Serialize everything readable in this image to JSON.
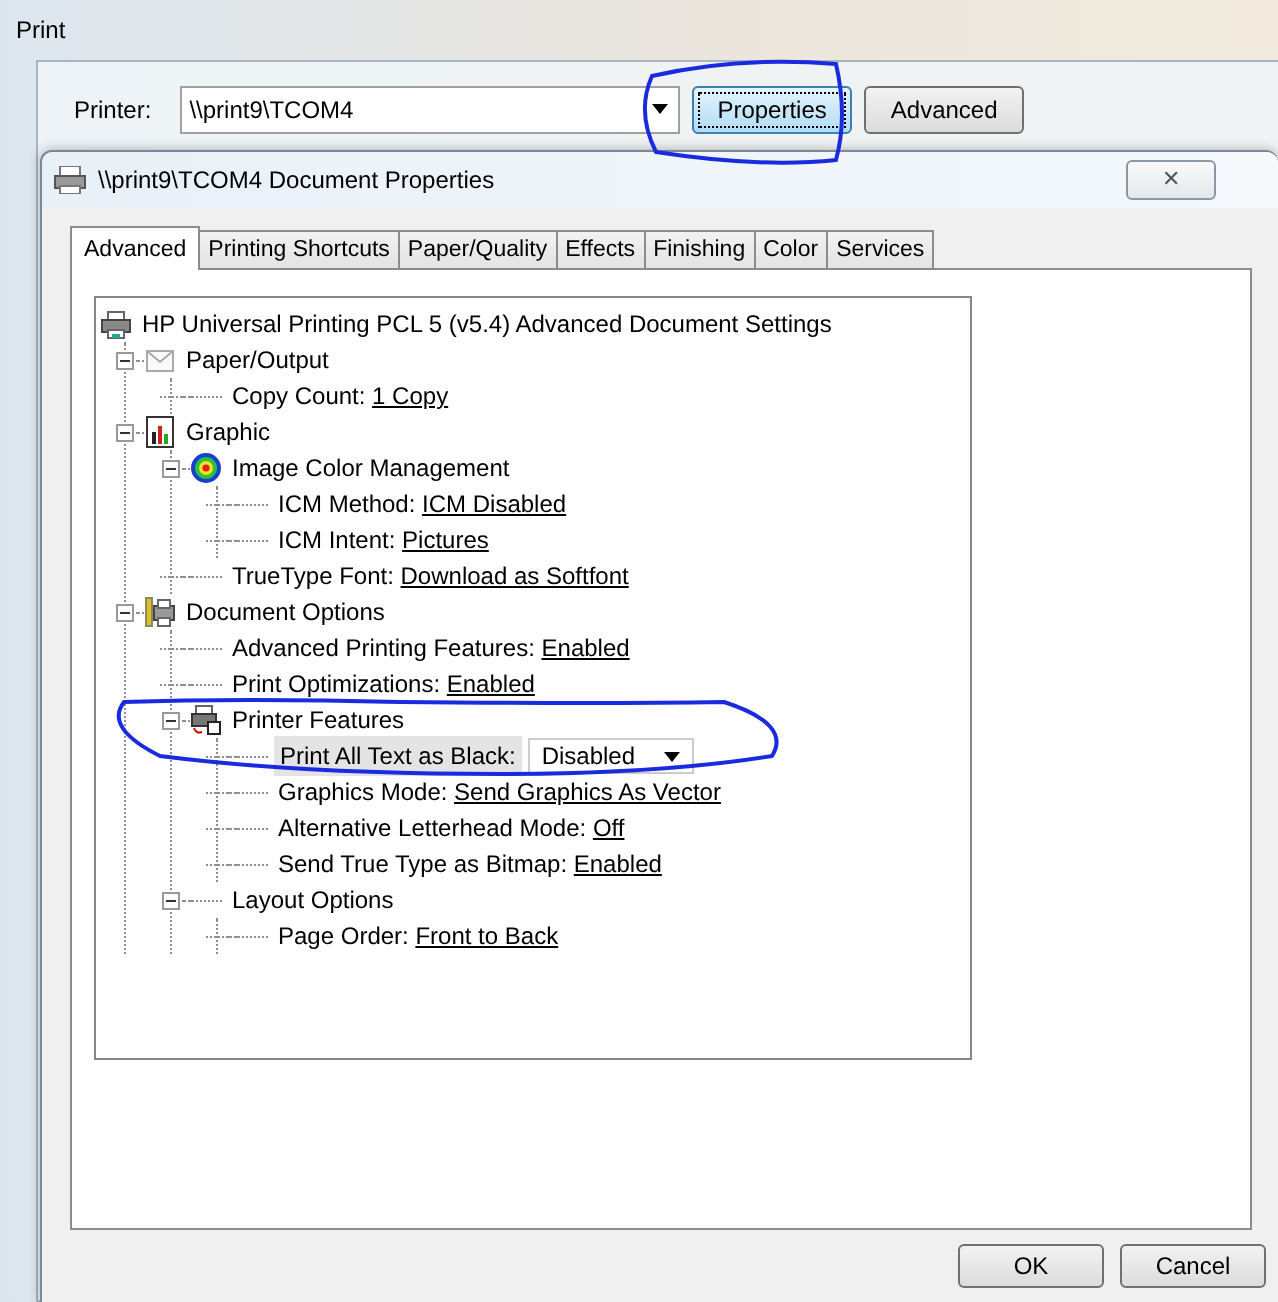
{
  "window": {
    "title": "Print"
  },
  "printer": {
    "label": "Printer:",
    "value": "\\\\print9\\TCOM4"
  },
  "buttons": [
    {
      "label": "Properties",
      "focused": true
    },
    {
      "label": "Advanced",
      "focused": false
    }
  ],
  "dialog": {
    "title": "\\\\print9\\TCOM4 Document Properties",
    "close": "✕"
  },
  "tabs": [
    {
      "label": "Advanced",
      "selected": true
    },
    {
      "label": "Printing Shortcuts",
      "selected": false
    },
    {
      "label": "Paper/Quality",
      "selected": false
    },
    {
      "label": "Effects",
      "selected": false
    },
    {
      "label": "Finishing",
      "selected": false
    },
    {
      "label": "Color",
      "selected": false
    },
    {
      "label": "Services",
      "selected": false
    }
  ],
  "tree": {
    "kind": "group",
    "label": "HP Universal Printing PCL 5 (v5.4) Advanced Document Settings",
    "children": [
      {
        "kind": "group",
        "label": "Paper/Output",
        "expanded": true,
        "children": [
          {
            "kind": "setting",
            "label": "Copy Count:",
            "value": "1 Copy",
            "selected": false
          }
        ]
      },
      {
        "kind": "group",
        "label": "Graphic",
        "expanded": true,
        "children": [
          {
            "kind": "group",
            "label": "Image Color Management",
            "expanded": true,
            "children": [
              {
                "kind": "setting",
                "label": "ICM Method:",
                "value": "ICM Disabled",
                "selected": false
              },
              {
                "kind": "setting",
                "label": "ICM Intent:",
                "value": "Pictures",
                "selected": false
              }
            ]
          },
          {
            "kind": "setting",
            "label": "TrueType Font:",
            "value": "Download as Softfont",
            "selected": false
          }
        ]
      },
      {
        "kind": "group",
        "label": "Document Options",
        "expanded": true,
        "children": [
          {
            "kind": "setting",
            "label": "Advanced Printing Features:",
            "value": "Enabled",
            "selected": false
          },
          {
            "kind": "setting",
            "label": "Print Optimizations:",
            "value": "Enabled",
            "selected": false
          },
          {
            "kind": "group",
            "label": "Printer Features",
            "expanded": true,
            "children": [
              {
                "kind": "dropdown",
                "label": "Print All Text as Black:",
                "value": "Disabled",
                "selected": true
              },
              {
                "kind": "setting",
                "label": "Graphics Mode:",
                "value": "Send Graphics As Vector",
                "selected": false
              },
              {
                "kind": "setting",
                "label": "Alternative Letterhead Mode:",
                "value": "Off",
                "selected": false
              },
              {
                "kind": "setting",
                "label": "Send True Type as Bitmap:",
                "value": "Enabled",
                "selected": false
              }
            ]
          },
          {
            "kind": "group",
            "label": "Layout Options",
            "expanded": true,
            "children": [
              {
                "kind": "setting",
                "label": "Page Order:",
                "value": "Front to Back",
                "selected": false
              }
            ]
          }
        ]
      }
    ]
  },
  "footer_buttons": [
    {
      "label": "OK"
    },
    {
      "label": "Cancel"
    }
  ]
}
